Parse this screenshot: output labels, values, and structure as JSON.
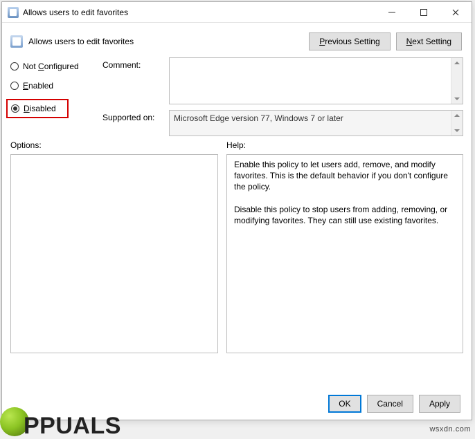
{
  "window": {
    "title": "Allows users to edit favorites"
  },
  "header": {
    "title": "Allows users to edit favorites",
    "prev_btn": "Previous Setting",
    "next_btn": "Next Setting"
  },
  "state": {
    "not_configured": "Not Configured",
    "enabled": "Enabled",
    "disabled": "Disabled",
    "selected": "disabled"
  },
  "fields": {
    "comment_label": "Comment:",
    "comment_value": "",
    "supported_label": "Supported on:",
    "supported_value": "Microsoft Edge version 77, Windows 7 or later"
  },
  "lower": {
    "options_label": "Options:",
    "help_label": "Help:",
    "help_text": "Enable this policy to let users add, remove, and modify favorites. This is the default behavior if you don't configure the policy.\n\nDisable this policy to stop users from adding, removing, or modifying favorites. They can still use existing favorites."
  },
  "actions": {
    "ok": "OK",
    "cancel": "Cancel",
    "apply": "Apply"
  },
  "watermark": "wsxdn.com",
  "brand": "PPUALS"
}
